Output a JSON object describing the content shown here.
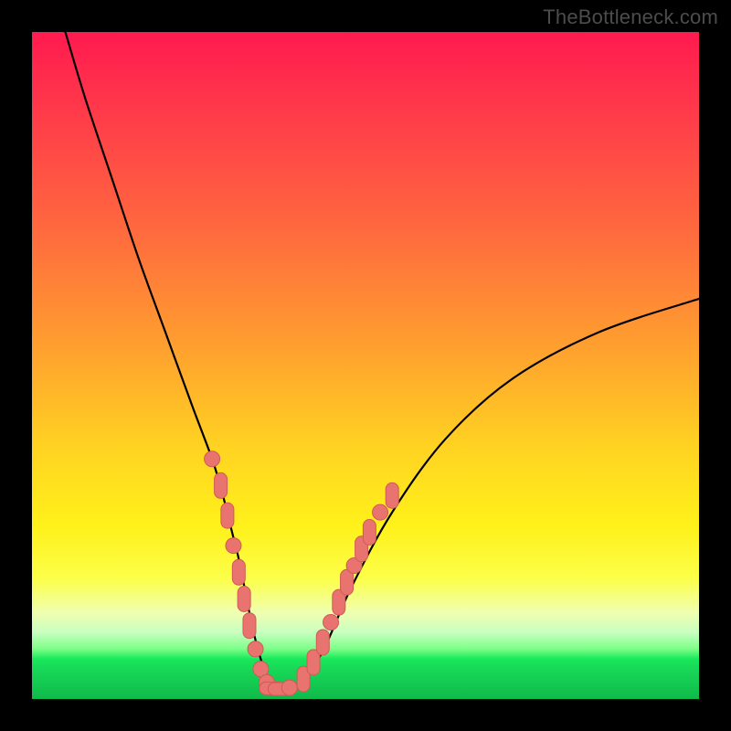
{
  "watermark": "TheBottleneck.com",
  "chart_data": {
    "type": "line",
    "title": "",
    "xlabel": "",
    "ylabel": "",
    "xlim": [
      0,
      100
    ],
    "ylim": [
      0,
      100
    ],
    "series": [
      {
        "name": "bottleneck-curve",
        "x": [
          5,
          8,
          12,
          16,
          20,
          24,
          27,
          28.5,
          30,
          31,
          32,
          33,
          34,
          35,
          36,
          37.5,
          39,
          41,
          44,
          48,
          54,
          62,
          72,
          85,
          100
        ],
        "values": [
          100,
          90,
          78,
          66,
          55,
          44,
          36,
          31,
          25,
          21,
          16,
          11,
          7,
          4,
          2,
          1.5,
          1.7,
          3,
          8,
          17,
          28,
          39,
          48,
          55,
          60
        ]
      }
    ],
    "markers": {
      "name": "highlighted-points",
      "color": "#e9746f",
      "stroke": "#d05a54",
      "points": [
        {
          "x": 27.0,
          "y": 36.0,
          "shape": "circle"
        },
        {
          "x": 28.3,
          "y": 32.0,
          "shape": "pill-v"
        },
        {
          "x": 29.3,
          "y": 27.5,
          "shape": "pill-v"
        },
        {
          "x": 30.2,
          "y": 23.0,
          "shape": "circle"
        },
        {
          "x": 31.0,
          "y": 19.0,
          "shape": "pill-v"
        },
        {
          "x": 31.8,
          "y": 15.0,
          "shape": "pill-v"
        },
        {
          "x": 32.6,
          "y": 11.0,
          "shape": "pill-v"
        },
        {
          "x": 33.5,
          "y": 7.5,
          "shape": "circle"
        },
        {
          "x": 34.3,
          "y": 4.5,
          "shape": "circle"
        },
        {
          "x": 35.2,
          "y": 2.5,
          "shape": "circle"
        },
        {
          "x": 36.0,
          "y": 1.6,
          "shape": "pill-h"
        },
        {
          "x": 37.3,
          "y": 1.5,
          "shape": "pill-h"
        },
        {
          "x": 38.6,
          "y": 1.7,
          "shape": "circle"
        },
        {
          "x": 40.7,
          "y": 3.0,
          "shape": "pill-v"
        },
        {
          "x": 42.2,
          "y": 5.5,
          "shape": "pill-v"
        },
        {
          "x": 43.6,
          "y": 8.5,
          "shape": "pill-v"
        },
        {
          "x": 44.8,
          "y": 11.5,
          "shape": "circle"
        },
        {
          "x": 46.0,
          "y": 14.5,
          "shape": "pill-v"
        },
        {
          "x": 47.2,
          "y": 17.5,
          "shape": "pill-v"
        },
        {
          "x": 48.3,
          "y": 20.0,
          "shape": "circle"
        },
        {
          "x": 49.4,
          "y": 22.5,
          "shape": "pill-v"
        },
        {
          "x": 50.6,
          "y": 25.0,
          "shape": "pill-v"
        },
        {
          "x": 52.2,
          "y": 28.0,
          "shape": "circle"
        },
        {
          "x": 54.0,
          "y": 30.5,
          "shape": "pill-v"
        }
      ]
    },
    "legend": null,
    "grid": false
  }
}
